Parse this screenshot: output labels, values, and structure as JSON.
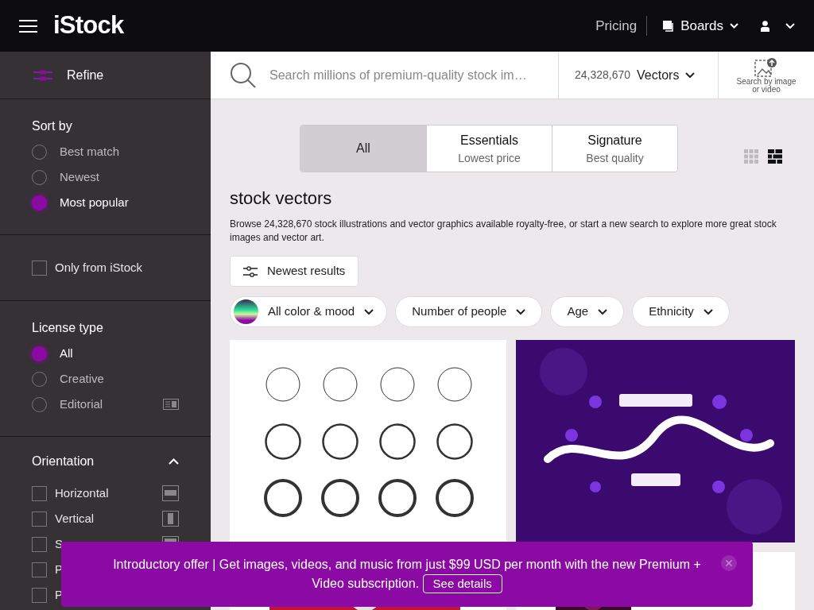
{
  "header": {
    "logo": "iStock",
    "pricing": "Pricing",
    "boards": "Boards"
  },
  "sidebar": {
    "refine": "Refine",
    "sort_by": {
      "title": "Sort by",
      "options": [
        {
          "label": "Best match",
          "selected": false
        },
        {
          "label": "Newest",
          "selected": false
        },
        {
          "label": "Most popular",
          "selected": true
        }
      ]
    },
    "only_from_istock": {
      "label": "Only from iStock",
      "checked": false
    },
    "license_type": {
      "title": "License type",
      "options": [
        {
          "label": "All",
          "selected": true,
          "kind": "plain"
        },
        {
          "label": "Creative",
          "selected": false,
          "kind": "plain"
        },
        {
          "label": "Editorial",
          "selected": false,
          "kind": "editorial"
        }
      ]
    },
    "orientation": {
      "title": "Orientation",
      "expanded": true,
      "options": [
        {
          "label": "Horizontal",
          "checked": false,
          "kind": "horizontal"
        },
        {
          "label": "Vertical",
          "checked": false,
          "kind": "vertical"
        },
        {
          "label": "S",
          "checked": false,
          "kind": "square"
        },
        {
          "label": "P",
          "checked": false,
          "kind": "plain"
        },
        {
          "label": "P",
          "checked": false,
          "kind": "plain"
        }
      ]
    }
  },
  "search": {
    "placeholder": "Search millions of premium-quality stock im…",
    "count": "24,328,670",
    "type": "Vectors",
    "image_search": "Search by image or video"
  },
  "tabs": [
    {
      "title": "All",
      "selected": true
    },
    {
      "title": "Essentials",
      "subtitle": "Lowest price",
      "selected": false
    },
    {
      "title": "Signature",
      "subtitle": "Best quality",
      "selected": false
    }
  ],
  "view_toggles": [
    {
      "kind": "grid",
      "selected": false
    },
    {
      "kind": "mosaic",
      "selected": true
    }
  ],
  "heading": "stock vectors",
  "description": "Browse 24,328,670 stock illustrations and vector graphics available royalty-free, or start a new search to explore more great stock images and vector art.",
  "newest_button": "Newest results",
  "filters": [
    {
      "label": "All color & mood",
      "kind": "color"
    },
    {
      "label": "Number of people",
      "kind": "plain"
    },
    {
      "label": "Age",
      "kind": "plain"
    },
    {
      "label": "Ethnicity",
      "kind": "plain"
    }
  ],
  "banner": {
    "text": "Introductory offer | Get images, videos, and music from just $99 USD per month with the new Premium + Video subscription.",
    "link": "See details"
  }
}
